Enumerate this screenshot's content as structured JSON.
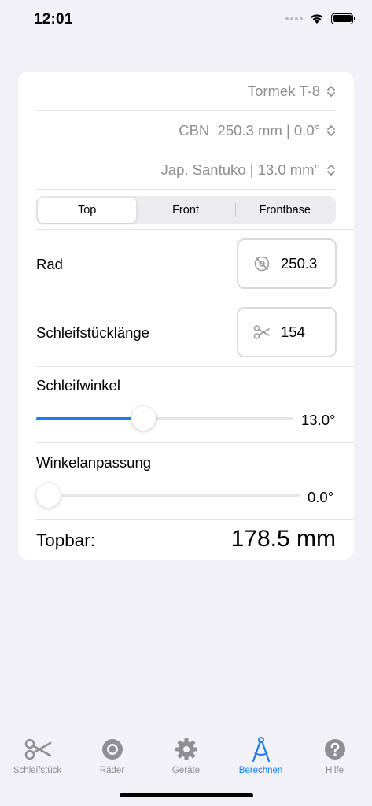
{
  "status_bar": {
    "time": "12:01"
  },
  "pickers": {
    "device": "Tormek T-8",
    "wheel": "CBN  250.3 mm | 0.0°",
    "knife": "Jap. Santuko | 13.0 mm°"
  },
  "segments": [
    "Top",
    "Front",
    "Frontbase"
  ],
  "selected_segment": "Top",
  "fields": {
    "rad_label": "Rad",
    "rad_value": "250.3",
    "length_label": "Schleifstücklänge",
    "length_value": "154"
  },
  "sliders": {
    "schleifwinkel_label": "Schleifwinkel",
    "schleifwinkel_value": "13.0°",
    "schleifwinkel_fraction": 0.41,
    "winkelanpassung_label": "Winkelanpassung",
    "winkelanpassung_value": "0.0°",
    "winkelanpassung_fraction": 0.0
  },
  "result": {
    "label": "Topbar:",
    "value": "178.5 mm"
  },
  "tabs": [
    {
      "label": "Schleifstück",
      "icon": "scissors-icon"
    },
    {
      "label": "Räder",
      "icon": "wheel-icon"
    },
    {
      "label": "Geräte",
      "icon": "gear-icon"
    },
    {
      "label": "Berechnen",
      "icon": "compass-icon"
    },
    {
      "label": "Hilfe",
      "icon": "help-icon"
    }
  ],
  "active_tab": "Berechnen",
  "colors": {
    "accent": "#1d7cf2",
    "background": "#f2f1f7",
    "secondary_text": "#8e8e93"
  }
}
